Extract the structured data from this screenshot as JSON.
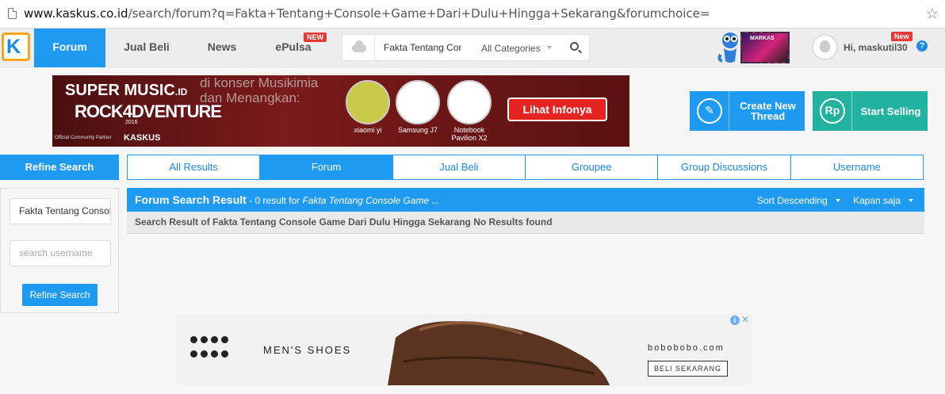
{
  "browser": {
    "url_host": "www.kaskus.co.id",
    "url_path": "/search/forum?q=Fakta+Tentang+Console+Game+Dari+Dulu+Hingga+Sekarang&forumchoice="
  },
  "nav": {
    "items": [
      "Forum",
      "Jual Beli",
      "News",
      "ePulsa"
    ],
    "active": "Forum",
    "epulsa_badge": "NEW",
    "search_value": "Fakta Tentang Console Game Dari Dulu Hingga Sekarang",
    "category": "All Categories",
    "user_greeting": "Hi, maskutil30",
    "user_badge": "New",
    "markas_text": "MARKAS"
  },
  "banner": {
    "brand": "SUPER MUSIC",
    "brand_suffix": ".ID",
    "event": "ROCK4DVENTURE",
    "year": "2016",
    "official": "Official Community Partner",
    "partner": "KASKUS",
    "promo": "di konser Musikimia dan Menangkan:",
    "products": [
      "xiaomi yi",
      "Samsung J7",
      "Notebook Pavilion X2"
    ],
    "cta": "Lihat Infonya"
  },
  "actions": {
    "create": "Create New Thread",
    "sell": "Start Selling",
    "sell_icon": "Rp"
  },
  "refine": {
    "title": "Refine Search",
    "query": "Fakta Tentang Console Game Dari Dulu Hingga Sekarang",
    "username_placeholder": "search username",
    "button": "Refine Search"
  },
  "tabs": [
    "All Results",
    "Forum",
    "Jual Beli",
    "Groupee",
    "Group Discussions",
    "Username"
  ],
  "active_tab": "Forum",
  "results": {
    "title": "Forum Search Result",
    "count_text": " - 0 result for ",
    "query_short": "Fakta Tentang Console Game ...",
    "sort": "Sort Descending",
    "when": "Kapan saja",
    "message": "Search Result of Fakta Tentang Console Game Dari Dulu Hingga Sekarang No Results found"
  },
  "ad": {
    "headline": "MEN'S SHOES",
    "brand": "bobobobo.com",
    "cta": "BELI SEKARANG"
  },
  "colors": {
    "primary": "#1e9bf0",
    "teal": "#21b3a0",
    "badge": "#e53935",
    "banner_red": "#7a1a1a"
  }
}
